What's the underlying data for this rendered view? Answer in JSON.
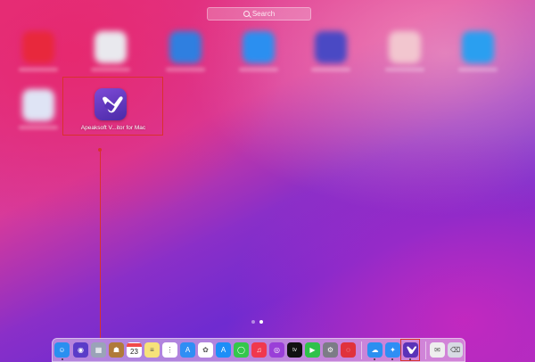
{
  "search": {
    "placeholder": "Search"
  },
  "launchpad": {
    "highlighted_app": {
      "label": "Apeaksoft V...itor for Mac",
      "icon": "apeaksoft-video-editor-icon"
    },
    "blurred_apps": [
      {
        "icon": "red-app-icon",
        "color": "#e8283c"
      },
      {
        "icon": "document-app-icon",
        "color": "#e9e9ee"
      },
      {
        "icon": "blue-globe-app-icon",
        "color": "#2f7fe0"
      },
      {
        "icon": "blue-app-icon",
        "color": "#2b8ff0"
      },
      {
        "icon": "purple-globe-app-icon",
        "color": "#4a49c4"
      },
      {
        "icon": "pink-tool-app-icon",
        "color": "#f2c6cf"
      },
      {
        "icon": "light-blue-app-icon",
        "color": "#2a9ff0"
      },
      {
        "icon": "light-app-icon",
        "color": "#dfe4f5"
      }
    ],
    "pages": {
      "count": 2,
      "current": 2
    }
  },
  "dock": {
    "calendar_day": "23",
    "apple_tv_label": "tv",
    "items": [
      {
        "name": "finder-icon",
        "color": "#2a8ff0",
        "glyph": "☺"
      },
      {
        "name": "siri-icon",
        "color": "#5a3cc8",
        "glyph": "◉"
      },
      {
        "name": "launchpad-icon",
        "color": "#9aa3b8",
        "glyph": "▦"
      },
      {
        "name": "contacts-icon",
        "color": "#b07a3a",
        "glyph": "☗"
      },
      {
        "name": "calendar-icon",
        "color": "#ffffff",
        "glyph": ""
      },
      {
        "name": "notes-icon",
        "color": "#f6e27a",
        "glyph": "≡"
      },
      {
        "name": "reminders-icon",
        "color": "#ffffff",
        "glyph": "⋮"
      },
      {
        "name": "app-store-search-icon",
        "color": "#2f8ef4",
        "glyph": "A"
      },
      {
        "name": "photos-icon",
        "color": "#ffffff",
        "glyph": "✿"
      },
      {
        "name": "app-store-icon",
        "color": "#1e8ef7",
        "glyph": "A"
      },
      {
        "name": "messages-icon",
        "color": "#33c74c",
        "glyph": "◯"
      },
      {
        "name": "music-icon",
        "color": "#f0384e",
        "glyph": "♫"
      },
      {
        "name": "podcasts-icon",
        "color": "#9a3fd8",
        "glyph": "◎"
      },
      {
        "name": "apple-tv-icon",
        "color": "#111111",
        "glyph": ""
      },
      {
        "name": "facetime-icon",
        "color": "#2fc24a",
        "glyph": "▶"
      },
      {
        "name": "system-preferences-icon",
        "color": "#7c7c86",
        "glyph": "⚙"
      },
      {
        "name": "netease-music-icon",
        "color": "#e0323c",
        "glyph": "◌"
      },
      {
        "name": "cloud-app-icon",
        "color": "#2a8ff0",
        "glyph": "☁"
      },
      {
        "name": "safari-icon",
        "color": "#2f8ef4",
        "glyph": "✦"
      },
      {
        "name": "apeaksoft-dock-icon",
        "color": "#5a33b8",
        "glyph": ""
      },
      {
        "name": "mail-icon",
        "color": "#eeeeee",
        "glyph": "✉"
      },
      {
        "name": "trash-icon",
        "color": "#d7dbe3",
        "glyph": "⌫"
      }
    ]
  }
}
